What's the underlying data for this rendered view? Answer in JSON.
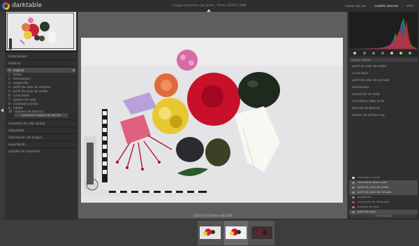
{
  "app": {
    "brand": "darktable",
    "filename": "imagenes/ramos del jardin / flores 2019 1 RAW",
    "views": [
      "mesa de luz",
      "cuarto oscuro",
      "otro"
    ],
    "active_view": "cuarto oscuro",
    "separator": "|"
  },
  "left_panel": {
    "rows": [
      {
        "label": "instantáneas",
        "dots": "··"
      },
      {
        "label": "histórico",
        "dots": "··"
      },
      {
        "label": "0 - original",
        "dots": "▪"
      },
      {
        "label": "1 - fondo",
        "dots": "··"
      },
      {
        "label": "2 - desmosaico",
        "dots": "··"
      },
      {
        "label": "3 - exposición",
        "dots": "··"
      },
      {
        "label": "4 - perfil de color de entrada",
        "dots": "··"
      },
      {
        "label": "5 - perfil de color de salida",
        "dots": "··"
      },
      {
        "label": "6 - curva base",
        "dots": "··"
      },
      {
        "label": "7 - ajustes de color",
        "dots": "··"
      },
      {
        "label": "8 - contraste y brillo",
        "dots": "··"
      },
      {
        "label": "9 - nitidez",
        "dots": "··"
      },
      {
        "label": "10 - balance de blancos",
        "dots": "··"
      }
    ],
    "compress_button": "comprimir historial de edición",
    "sections": [
      {
        "label": "muestreo de color global",
        "dots": "··"
      },
      {
        "label": "etiquetado",
        "dots": "··"
      },
      {
        "label": "información de imagen",
        "dots": "··"
      },
      {
        "label": "exportación",
        "dots": "··"
      },
      {
        "label": "pantalla de impresión",
        "dots": "··"
      }
    ]
  },
  "center": {
    "status": "1/250 f/5.6 50mm ISO 200"
  },
  "right_panel": {
    "modules": [
      {
        "label": "perfil de color de salida",
        "dots": "··"
      },
      {
        "label": "curva base",
        "dots": "··"
      },
      {
        "label": "perfil de color de entrada",
        "dots": "··"
      },
      {
        "label": "desmosaico",
        "dots": "··"
      },
      {
        "label": "corrección de color",
        "dots": "··"
      },
      {
        "label": "reconstruir altas luces",
        "dots": "··"
      },
      {
        "label": "balance de blancos",
        "dots": "··"
      },
      {
        "label": "lectura de archivo raw",
        "dots": "··"
      }
    ],
    "search_header": "buscar módulo",
    "history_items": [
      {
        "label": "contraste y brillo",
        "hl": false,
        "color": "#e6e6a0"
      },
      {
        "label": "reconstruir altas luces",
        "hl": true,
        "color": "#9a9a9a"
      },
      {
        "label": "perfil de color de salida",
        "hl": true,
        "color": "#9a9a9a"
      },
      {
        "label": "perfil de color de entrada",
        "hl": true,
        "color": "#9a9a9a"
      },
      {
        "label": "exposición",
        "hl": false,
        "color": "#9a9a9a"
      },
      {
        "label": "corrección de distorsión",
        "hl": false,
        "color": "#d04050"
      },
      {
        "label": "balance de color",
        "hl": false,
        "color": "#9a9a9a"
      },
      {
        "label": "perfil de color",
        "hl": true,
        "color": "#9a9a9a"
      },
      {
        "label": "curva de tonos",
        "hl": false,
        "color": "#9a9a9a"
      }
    ],
    "more_modules_button": "más módulos"
  },
  "filmstrip": {
    "count": 3,
    "selected_index": 1
  },
  "colors": {
    "accent": "#d0d0d0",
    "panel": "#2f2f2f",
    "center_bg": "#5e5e5e"
  }
}
